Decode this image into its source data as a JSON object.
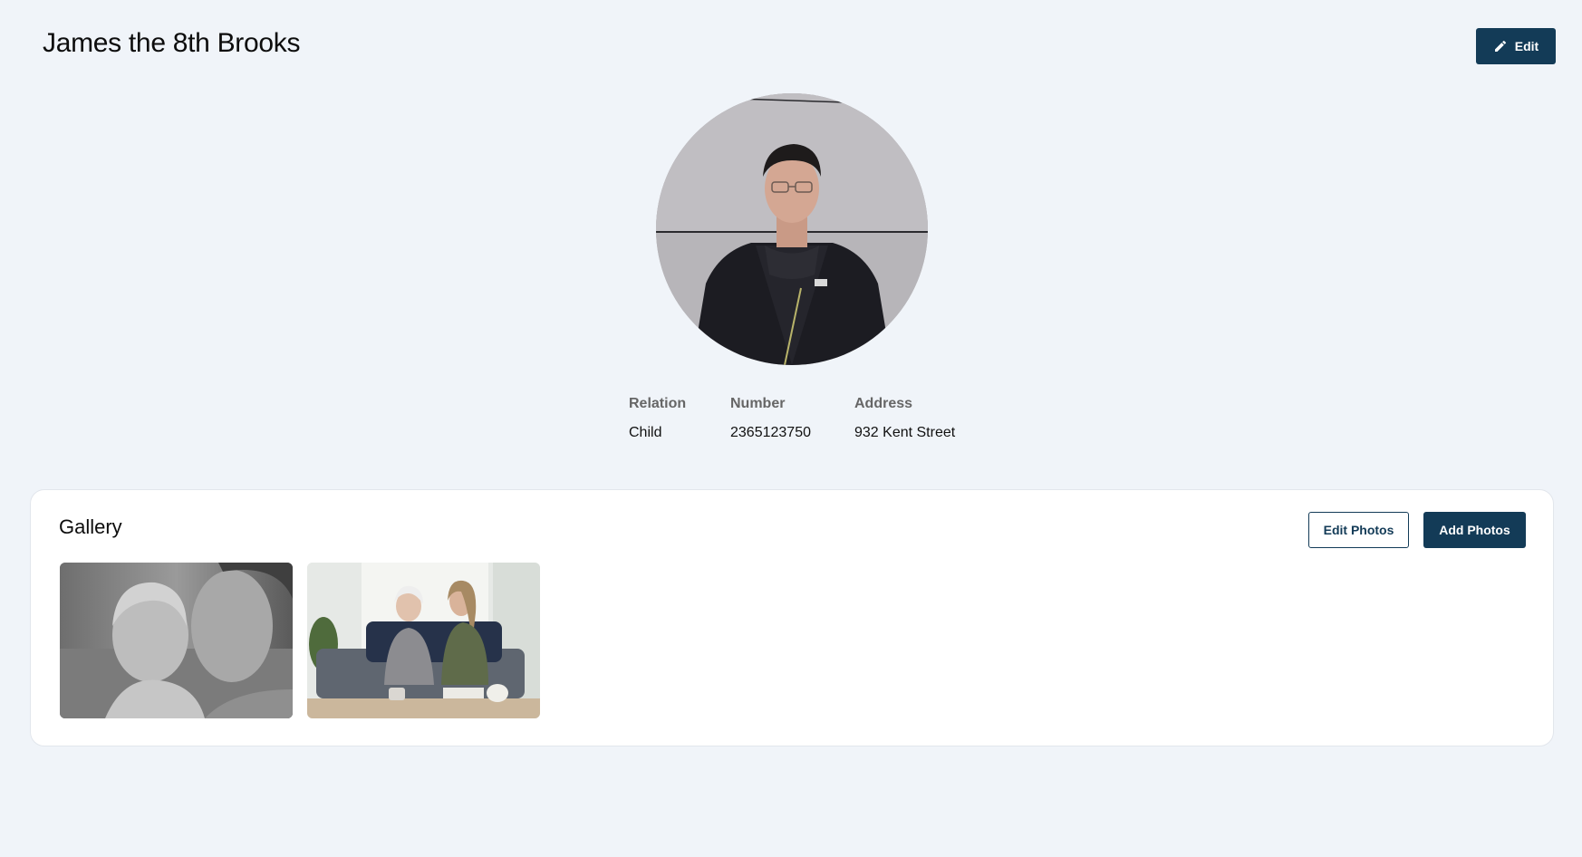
{
  "header": {
    "title": "James the 8th Brooks",
    "edit_label": "Edit"
  },
  "profile": {
    "fields": [
      {
        "label": "Relation",
        "value": "Child"
      },
      {
        "label": "Number",
        "value": "2365123750"
      },
      {
        "label": "Address",
        "value": "932 Kent Street"
      }
    ]
  },
  "gallery": {
    "title": "Gallery",
    "edit_photos_label": "Edit Photos",
    "add_photos_label": "Add Photos"
  },
  "colors": {
    "background": "#f0f4f9",
    "primary": "#133b57",
    "card": "#ffffff"
  },
  "icons": {
    "edit": "pencil-icon"
  }
}
